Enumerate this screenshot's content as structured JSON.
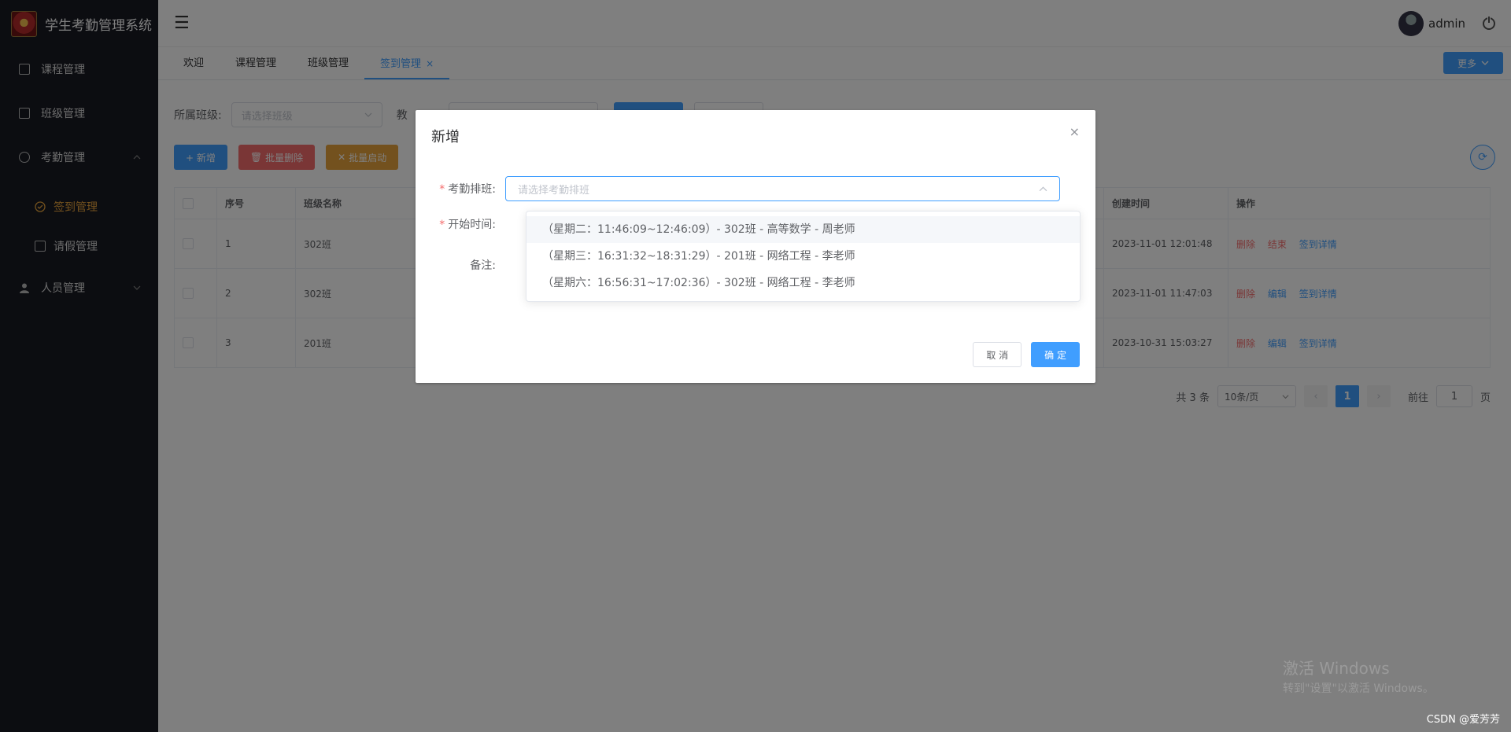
{
  "app": {
    "title": "学生考勤管理系统"
  },
  "sidebar": {
    "items": [
      {
        "label": "课程管理",
        "icon": "book-icon"
      },
      {
        "label": "班级管理",
        "icon": "building-icon"
      },
      {
        "label": "考勤管理",
        "icon": "clock-icon"
      },
      {
        "label": "签到管理",
        "icon": "check-circle-icon"
      },
      {
        "label": "请假管理",
        "icon": "document-icon"
      },
      {
        "label": "人员管理",
        "icon": "user-icon"
      }
    ]
  },
  "topbar": {
    "username": "admin"
  },
  "tabs": {
    "items": [
      "欢迎",
      "课程管理",
      "班级管理",
      "签到管理"
    ],
    "close": "×",
    "more": "更多"
  },
  "filter": {
    "class_label": "所属班级:",
    "class_placeholder": "请选择班级",
    "second_label": "教"
  },
  "actions": {
    "add": "+ 新增",
    "batch_delete": "批量删除",
    "batch_start": "批量启动"
  },
  "table": {
    "headers": [
      "序号",
      "班级名称",
      "创建时间",
      "操作"
    ],
    "rows": [
      {
        "no": "1",
        "class": "302班",
        "created": "2023-11-01 12:01:48",
        "ops": [
          "删除",
          "结束",
          "签到详情"
        ]
      },
      {
        "no": "2",
        "class": "302班",
        "created": "2023-11-01 11:47:03",
        "ops": [
          "删除",
          "编辑",
          "签到详情"
        ]
      },
      {
        "no": "3",
        "class": "201班",
        "created": "2023-10-31 15:03:27",
        "ops": [
          "删除",
          "编辑",
          "签到详情"
        ]
      }
    ]
  },
  "pagination": {
    "total": "共 3 条",
    "page_size": "10条/页",
    "current": "1",
    "goto_prefix": "前往",
    "goto_value": "1",
    "goto_suffix": "页"
  },
  "dialog": {
    "title": "新增",
    "close": "×",
    "field_schedule_label": "考勤排班:",
    "field_schedule_placeholder": "请选择考勤排班",
    "field_start_label": "开始时间:",
    "field_note_label": "备注:",
    "cancel": "取 消",
    "ok": "确 定"
  },
  "dropdown": {
    "options": [
      "（星期二：11:46:09~12:46:09）- 302班 - 高等数学 - 周老师",
      "（星期三：16:31:32~18:31:29）- 201班 - 网络工程 - 李老师",
      "（星期六：16:56:31~17:02:36）- 302班 - 网络工程 - 李老师"
    ]
  },
  "watermark": {
    "line1": "激活 Windows",
    "line2": "转到\"设置\"以激活 Windows。",
    "credit": "CSDN @爱芳芳"
  }
}
